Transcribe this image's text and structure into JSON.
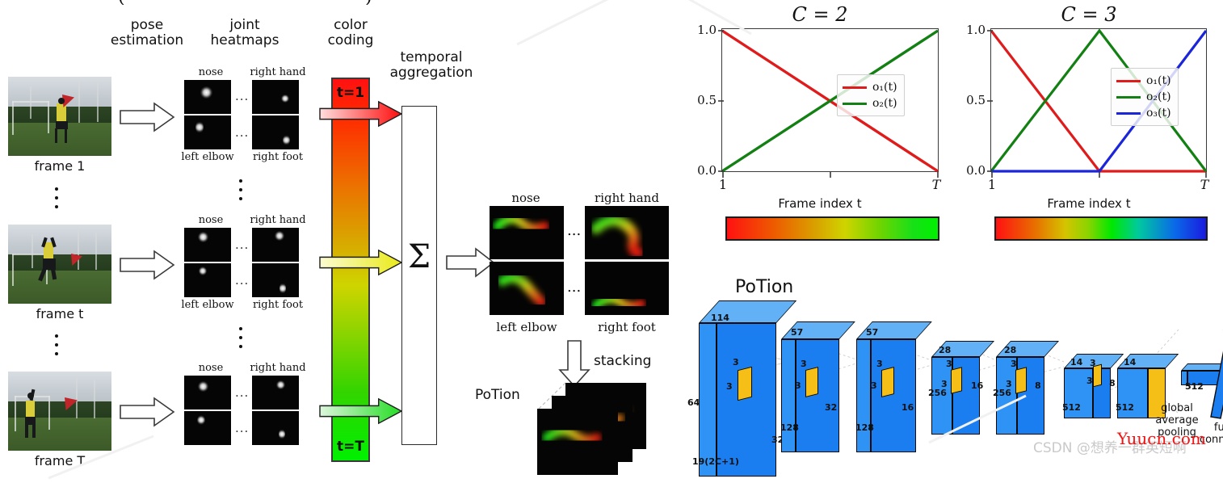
{
  "figure": {
    "column_headings": [
      "pose\nestimation",
      "joint\nheatmaps",
      "color\ncoding",
      "temporal\naggregation"
    ],
    "heading_pose_line1": "pose",
    "heading_pose_line2": "estimation",
    "heading_joint_line1": "joint",
    "heading_joint_line2": "heatmaps",
    "heading_color_line1": "color",
    "heading_color_line2": "coding",
    "heading_temporal_line1": "temporal",
    "heading_temporal_line2": "aggregation",
    "frames": [
      {
        "caption": "frame 1"
      },
      {
        "caption": "frame t"
      },
      {
        "caption": "frame T"
      }
    ],
    "heatmap_labels": {
      "top_left": "nose",
      "top_right": "right hand",
      "bottom_left": "left elbow",
      "bottom_right": "right foot"
    },
    "ellipsis": "...",
    "color_coding": {
      "top_chip": "t=1",
      "bottom_chip": "t=T",
      "gradient_start": "#ff1111",
      "gradient_mid": "#cfd400",
      "gradient_end": "#00f000",
      "arrow_colors": [
        "#ff1111",
        "#e8e820",
        "#2ee22e"
      ]
    },
    "sigma_symbol": "Σ",
    "potion_labels": {
      "top_left": "nose",
      "top_right": "right hand",
      "bottom_left": "left elbow",
      "bottom_right": "right foot"
    },
    "stacking_label": "stacking",
    "potion_label": "PoTion"
  },
  "chart_data": [
    {
      "type": "line",
      "title": "C = 2",
      "xlabel": "Frame index t",
      "ylabel": "",
      "xticks": [
        "1",
        "T"
      ],
      "yticks": [
        "0.0",
        "0.5",
        "1.0"
      ],
      "ylim": [
        0.0,
        1.0
      ],
      "xlim": [
        0,
        1
      ],
      "grid": false,
      "legend_position": "center-right",
      "series": [
        {
          "name": "o₁(t)",
          "color": "#e01b1b",
          "x": [
            0,
            1
          ],
          "values": [
            1.0,
            0.0
          ]
        },
        {
          "name": "o₂(t)",
          "color": "#138013",
          "x": [
            0,
            1
          ],
          "values": [
            0.0,
            1.0
          ]
        }
      ],
      "colorbar": {
        "stops": [
          "#ff1111",
          "#e07a00",
          "#cfd400",
          "#5fd400",
          "#00f000"
        ]
      }
    },
    {
      "type": "line",
      "title": "C = 3",
      "xlabel": "Frame index t",
      "ylabel": "",
      "xticks": [
        "1",
        "T"
      ],
      "yticks": [
        "0.0",
        "0.5",
        "1.0"
      ],
      "ylim": [
        0.0,
        1.0
      ],
      "xlim": [
        0,
        1
      ],
      "grid": false,
      "legend_position": "center-right",
      "series": [
        {
          "name": "o₁(t)",
          "color": "#e01b1b",
          "x": [
            0,
            0.5,
            1
          ],
          "values": [
            1.0,
            0.0,
            0.0
          ]
        },
        {
          "name": "o₂(t)",
          "color": "#138013",
          "x": [
            0,
            0.5,
            1
          ],
          "values": [
            0.0,
            1.0,
            0.0
          ]
        },
        {
          "name": "o₃(t)",
          "color": "#1a26d8",
          "x": [
            0,
            0.5,
            1
          ],
          "values": [
            0.0,
            0.0,
            1.0
          ]
        }
      ],
      "colorbar": {
        "stops": [
          "#ff1111",
          "#e07a00",
          "#cfd400",
          "#00e000",
          "#00c89a",
          "#1a26d8"
        ]
      }
    }
  ],
  "cnn": {
    "title": "PoTion",
    "blocks": [
      {
        "top_dim": "114",
        "left_dim": "64",
        "bottom_dim": "19(2C+1)",
        "right_dim": "32",
        "kernel_w": "3",
        "kernel_h": "3"
      },
      {
        "top_dim": "57",
        "left_dim": "",
        "bottom_dim": "128",
        "right_dim": "32",
        "kernel_w": "3",
        "kernel_h": "3"
      },
      {
        "top_dim": "57",
        "left_dim": "",
        "bottom_dim": "128",
        "right_dim": "16",
        "kernel_w": "3",
        "kernel_h": "3"
      },
      {
        "top_dim": "28",
        "left_dim": "",
        "bottom_dim": "256",
        "right_dim": "16",
        "kernel_w": "3",
        "kernel_h": "3"
      },
      {
        "top_dim": "28",
        "left_dim": "",
        "bottom_dim": "256",
        "right_dim": "8",
        "kernel_w": "3",
        "kernel_h": "3"
      },
      {
        "top_dim": "14",
        "left_dim": "",
        "bottom_dim": "512",
        "right_dim": "8",
        "kernel_w": "3",
        "kernel_h": "3"
      },
      {
        "top_dim": "14",
        "left_dim": "",
        "bottom_dim": "512",
        "right_dim": "",
        "kernel_w": "",
        "kernel_h": ""
      }
    ],
    "gap_label_line1": "global",
    "gap_label_line2": "average",
    "gap_label_line3": "pooling",
    "gap_vector_dim": "512",
    "fc_label_line1": "fully-",
    "fc_label_line2": "connected"
  },
  "watermarks": {
    "csdn": "CSDN @想养一群英短啊",
    "yuucn": "Yuucn.com"
  }
}
